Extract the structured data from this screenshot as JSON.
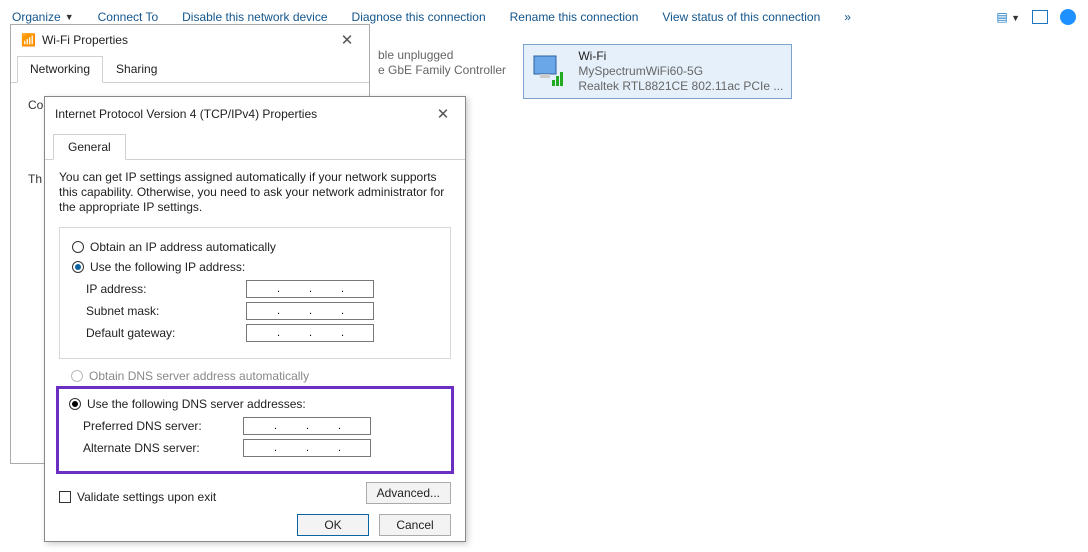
{
  "toolbar": {
    "items": [
      "Organize",
      "Connect To",
      "Disable this network device",
      "Diagnose this connection",
      "Rename this connection",
      "View status of this connection"
    ],
    "overflow": "»"
  },
  "netItems": {
    "left": {
      "line1": "ble unplugged",
      "line2": "e GbE Family Controller"
    },
    "right": {
      "name": "Wi-Fi",
      "ssid": "MySpectrumWiFi60-5G",
      "adapter": "Realtek RTL8821CE 802.11ac PCIe ..."
    }
  },
  "wifiProps": {
    "title": "Wi-Fi Properties",
    "tabs": [
      "Networking",
      "Sharing"
    ],
    "peek": {
      "co": "Co",
      "th": "Th"
    }
  },
  "ipv4": {
    "title": "Internet Protocol Version 4 (TCP/IPv4) Properties",
    "tab": "General",
    "help": "You can get IP settings assigned automatically if your network supports this capability. Otherwise, you need to ask your network administrator for the appropriate IP settings.",
    "ip": {
      "auto": "Obtain an IP address automatically",
      "manual": "Use the following IP address:",
      "fields": {
        "ip": "IP address:",
        "mask": "Subnet mask:",
        "gw": "Default gateway:"
      }
    },
    "dns": {
      "auto": "Obtain DNS server address automatically",
      "manual": "Use the following DNS server addresses:",
      "fields": {
        "pref": "Preferred DNS server:",
        "alt": "Alternate DNS server:"
      }
    },
    "validate": "Validate settings upon exit",
    "advanced": "Advanced...",
    "ok": "OK",
    "cancel": "Cancel"
  }
}
